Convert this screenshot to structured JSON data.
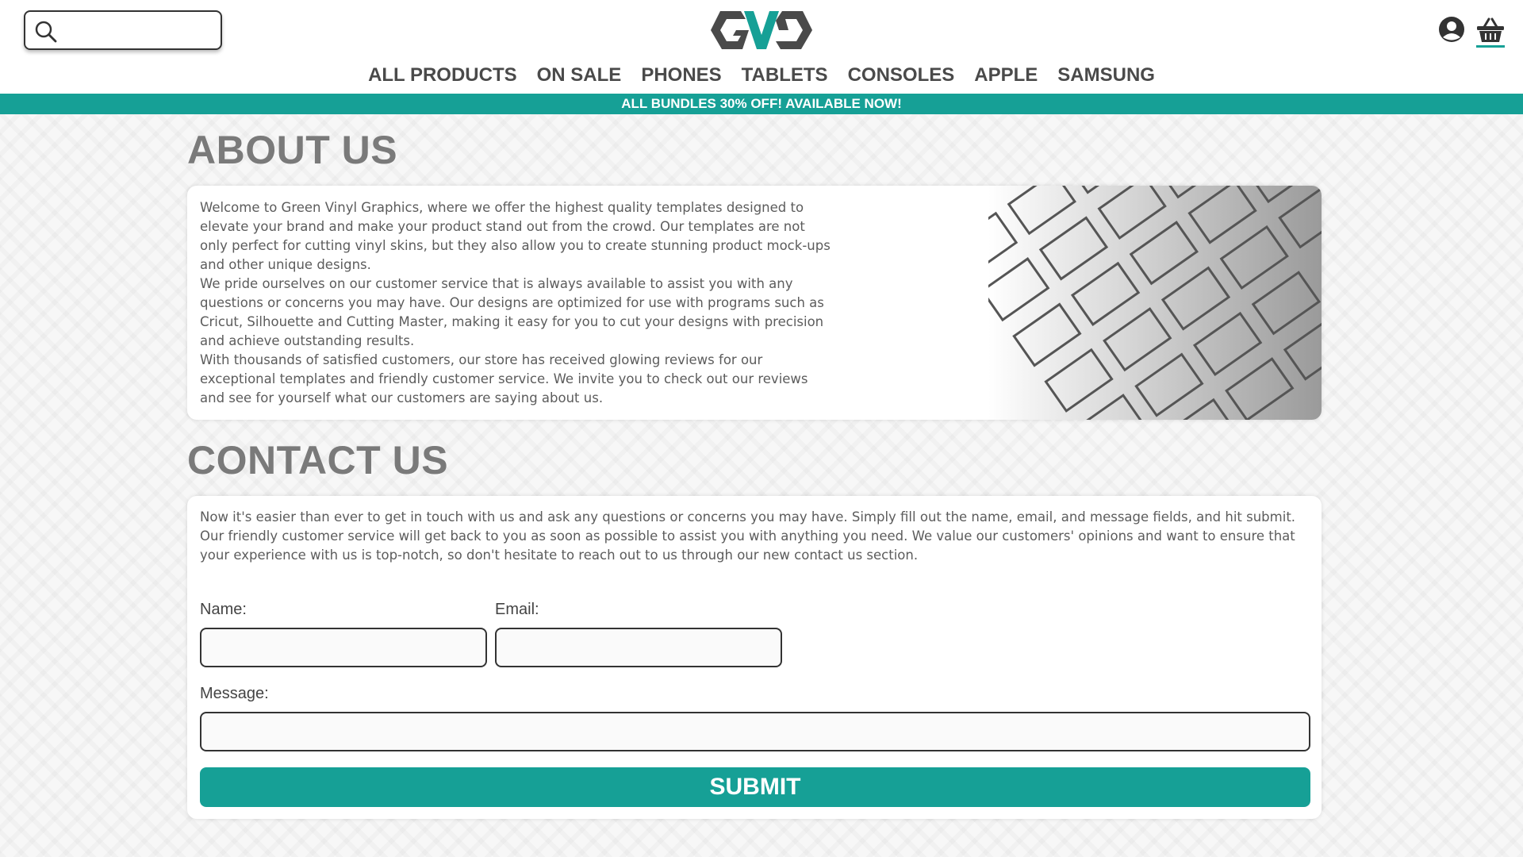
{
  "header": {
    "search": {
      "placeholder": "",
      "value": ""
    },
    "logo_alt": "GVG"
  },
  "nav": {
    "items": [
      "ALL PRODUCTS",
      "ON SALE",
      "PHONES",
      "TABLETS",
      "CONSOLES",
      "APPLE",
      "SAMSUNG"
    ]
  },
  "promo": {
    "text": "ALL BUNDLES 30% OFF! AVAILABLE NOW!"
  },
  "about": {
    "title": "ABOUT US",
    "paragraphs": [
      "Welcome to Green Vinyl Graphics, where we offer the highest quality templates designed to elevate your brand and make your product stand out from the crowd. Our templates are not only perfect for cutting vinyl skins, but they also allow you to create stunning product mock-ups and other unique designs.",
      "We pride ourselves on our customer service that is always available to assist you with any questions or concerns you may have. Our designs are optimized for use with programs such as Cricut, Silhouette and Cutting Master, making it easy for you to cut your designs with precision and achieve outstanding results.",
      "With thousands of satisfied customers, our store has received glowing reviews for our exceptional templates and friendly customer service. We invite you to check out our reviews and see for yourself what our customers are saying about us."
    ]
  },
  "contact": {
    "title": "CONTACT US",
    "intro": "Now it's easier than ever to get in touch with us and ask any questions or concerns you may have. Simply fill out the name, email, and message fields, and hit submit. Our friendly customer service will get back to you as soon as possible to assist you with anything you need. We value our customers' opinions and want to ensure that your experience with us is top-notch, so don't hesitate to reach out to us through our new contact us section.",
    "name_label": "Name:",
    "email_label": "Email:",
    "message_label": "Message:",
    "name_value": "",
    "email_value": "",
    "message_value": "",
    "submit_label": "SUBMIT"
  },
  "colors": {
    "accent": "#16a096",
    "heading": "#7a7a7a"
  }
}
